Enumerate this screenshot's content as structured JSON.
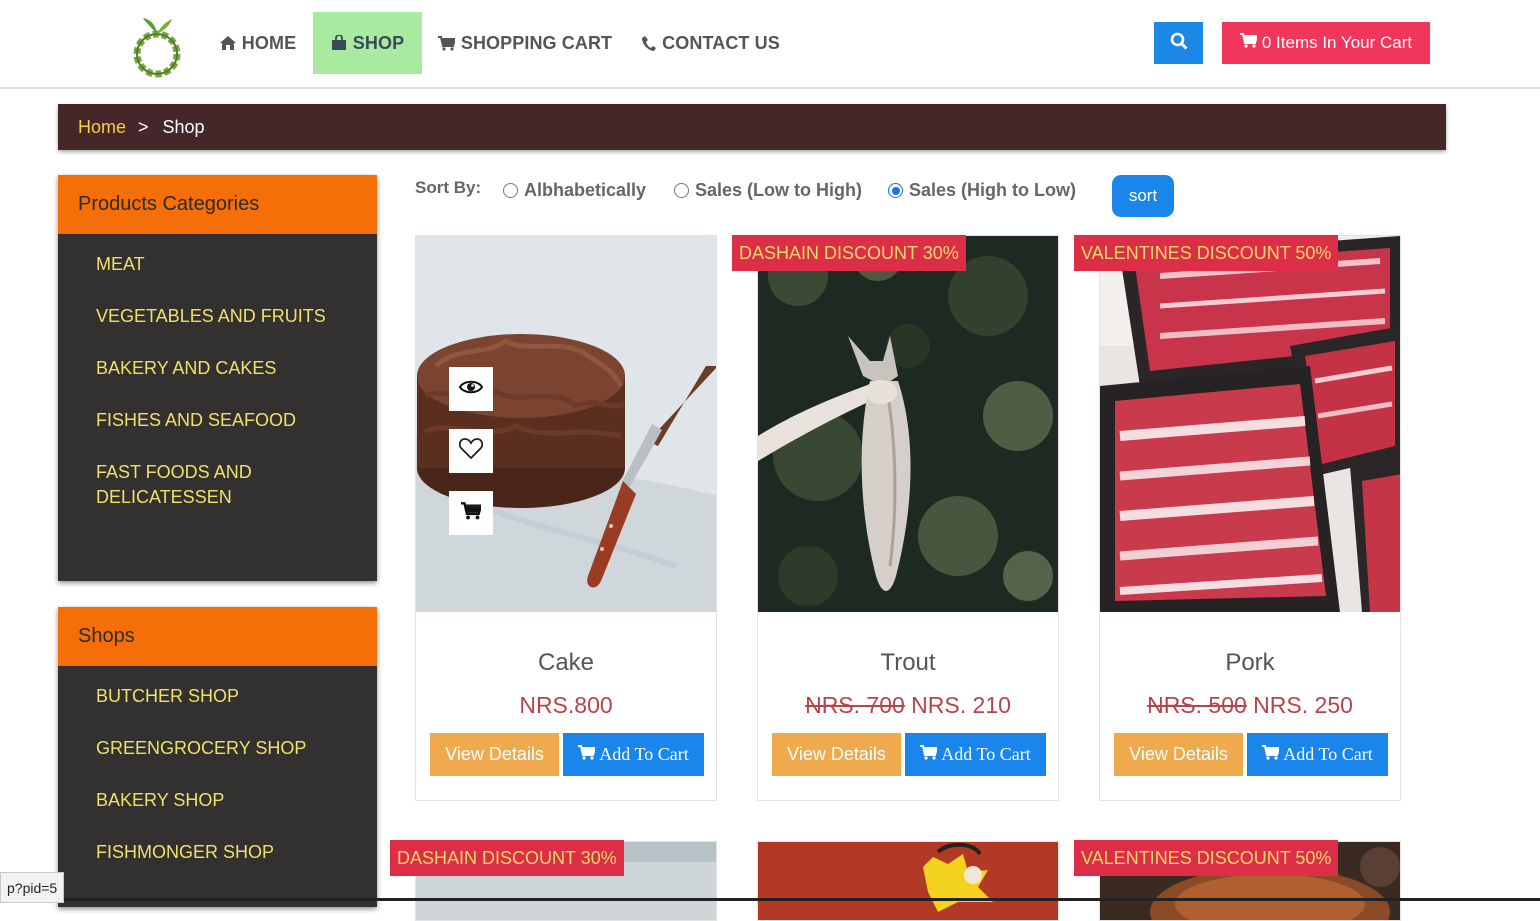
{
  "nav": {
    "items": [
      {
        "icon": "home-icon",
        "label": "HOME"
      },
      {
        "icon": "shopping-bag-icon",
        "label": "SHOP",
        "active": true
      },
      {
        "icon": "shopping-cart-icon",
        "label": "SHOPPING CART"
      },
      {
        "icon": "phone-icon",
        "label": "CONTACT US"
      }
    ],
    "search_icon": "search-icon",
    "cart_button": "0 Items In Your Cart"
  },
  "breadcrumb": {
    "home": "Home",
    "separator": ">",
    "current": "Shop"
  },
  "sidebar": {
    "categories": {
      "title": "Products Categories",
      "items": [
        "MEAT",
        "VEGETABLES AND FRUITS",
        "BAKERY AND CAKES",
        "FISHES AND SEAFOOD",
        "FAST FOODS AND DELICATESSEN"
      ]
    },
    "shops": {
      "title": "Shops",
      "items": [
        "BUTCHER SHOP",
        "GREENGROCERY SHOP",
        "BAKERY SHOP",
        "FISHMONGER SHOP"
      ]
    }
  },
  "sort": {
    "label": "Sort By:",
    "options": [
      "Albhabetically",
      "Sales (Low to High)",
      "Sales (High to Low)"
    ],
    "selected": "Sales (High to Low)",
    "button": "sort"
  },
  "products": [
    {
      "name": "Cake",
      "price": "NRS.800",
      "old_price": "",
      "badge": "",
      "view": "View Details",
      "add": "Add To Cart"
    },
    {
      "name": "Trout",
      "price": " NRS. 210",
      "old_price": "NRS. 700",
      "badge": "DASHAIN DISCOUNT 30%",
      "view": "View Details",
      "add": "Add To Cart"
    },
    {
      "name": "Pork",
      "price": " NRS. 250",
      "old_price": "NRS. 500",
      "badge": "VALENTINES DISCOUNT 50%",
      "view": "View Details",
      "add": "Add To Cart"
    }
  ],
  "next_row_badges": [
    "DASHAIN DISCOUNT 30%",
    "VALENTINES DISCOUNT 50%"
  ],
  "status_url": "p?pid=5",
  "colors": {
    "header_active": "#a8eba0",
    "breadcrumb_bg": "#45272a",
    "panel_header": "#f66e07",
    "panel_bg": "#333030",
    "panel_link": "#f0e06a",
    "accent_blue": "#1a86ec",
    "cart_pink": "#f0365a",
    "view_button": "#efaa4d",
    "badge_bg": "#dd2e48",
    "price": "#b5454a"
  }
}
